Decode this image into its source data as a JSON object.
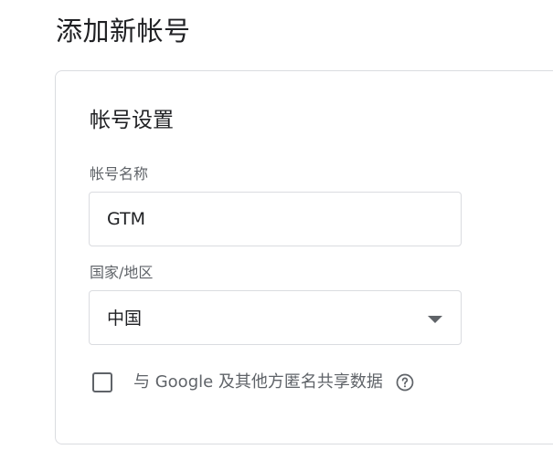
{
  "page": {
    "title": "添加新帐号"
  },
  "account_settings": {
    "section_title": "帐号设置",
    "account_name_label": "帐号名称",
    "account_name_value": "GTM",
    "country_label": "国家/地区",
    "country_value": "中国",
    "share_data_label": "与 Google 及其他方匿名共享数据",
    "share_data_checked": false
  },
  "icons": {
    "dropdown": "chevron-down-icon",
    "help": "help-circle-icon"
  },
  "colors": {
    "border": "#dadce0",
    "text_primary": "#202124",
    "text_secondary": "#5f6368"
  }
}
